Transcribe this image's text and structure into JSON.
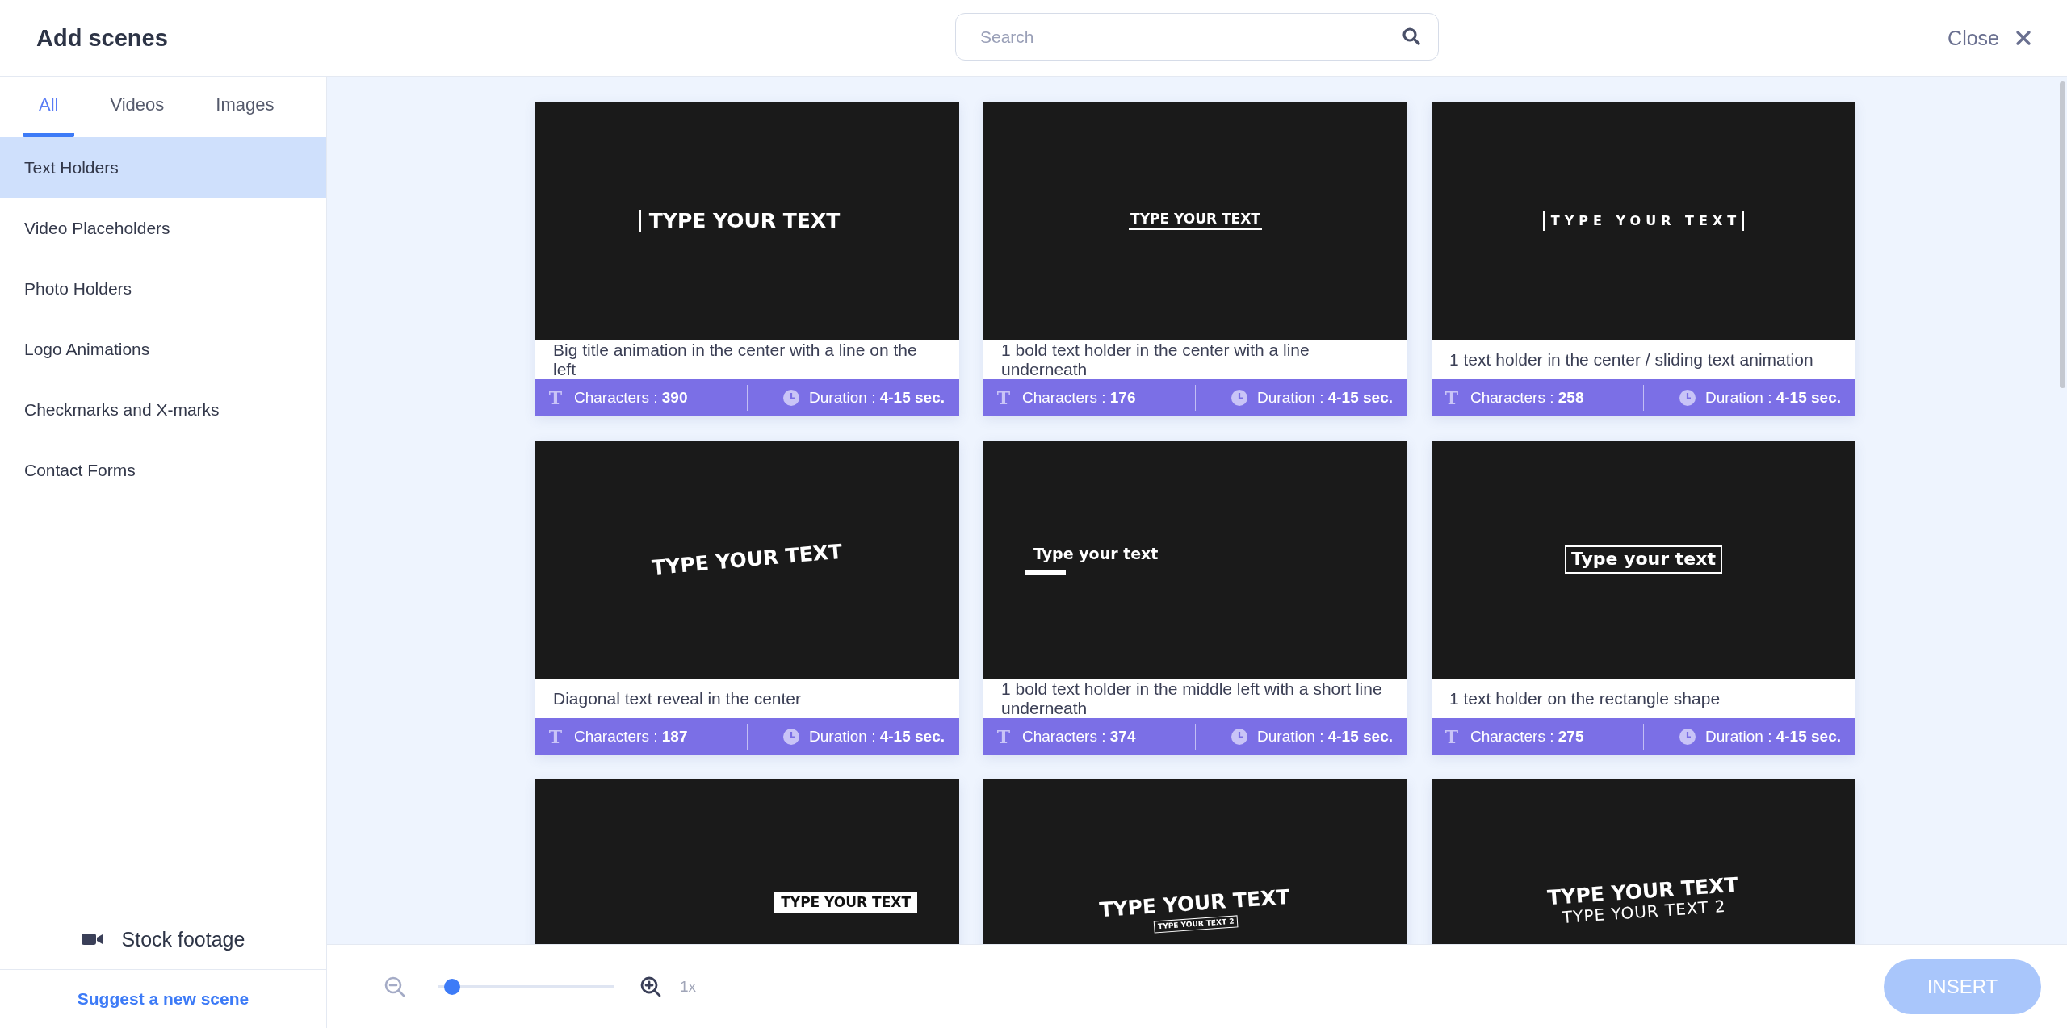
{
  "header": {
    "title": "Add scenes",
    "search": {
      "placeholder": "Search"
    },
    "close": "Close"
  },
  "sidebar": {
    "tabs": [
      {
        "label": "All",
        "selected": true
      },
      {
        "label": "Videos",
        "selected": false
      },
      {
        "label": "Images",
        "selected": false
      }
    ],
    "categories": [
      {
        "label": "Text Holders",
        "selected": true
      },
      {
        "label": "Video Placeholders",
        "selected": false
      },
      {
        "label": "Photo Holders",
        "selected": false
      },
      {
        "label": "Logo Animations",
        "selected": false
      },
      {
        "label": "Checkmarks and X-marks",
        "selected": false
      },
      {
        "label": "Contact Forms",
        "selected": false
      }
    ],
    "stock_footage": "Stock footage",
    "suggest_link": "Suggest a new scene"
  },
  "scenes": [
    {
      "preview": {
        "kind": "leftbar",
        "lines": [
          "TYPE YOUR TEXT"
        ]
      },
      "description": "Big title animation in the center with a line on the left",
      "footer": {
        "type_icon": "T",
        "characters": "Characters : **390**",
        "duration": "Duration : **4-15 sec.**"
      }
    },
    {
      "preview": {
        "kind": "underlined",
        "lines": [
          "TYPE YOUR TEXT"
        ]
      },
      "description": "1 bold text holder in the center with a line underneath",
      "footer": {
        "type_icon": "T",
        "characters": "Characters : **176**",
        "duration": "Duration : **4-15 sec.**"
      }
    },
    {
      "preview": {
        "kind": "bracketed",
        "lines": [
          "TYPE YOUR TEXT"
        ]
      },
      "description": "1 text holder in the center / sliding text animation",
      "footer": {
        "type_icon": "T",
        "characters": "Characters : **258**",
        "duration": "Duration : **4-15 sec.**"
      }
    },
    {
      "preview": {
        "kind": "diagonal",
        "lines": [
          "TYPE YOUR TEXT"
        ]
      },
      "description": "Diagonal text reveal in the center",
      "footer": {
        "type_icon": "T",
        "characters": "Characters : **187**",
        "duration": "Duration : **4-15 sec.**"
      }
    },
    {
      "preview": {
        "kind": "shortline",
        "lines": [
          "Type your text"
        ]
      },
      "description": "1 bold text holder in the middle left with a short line underneath",
      "footer": {
        "type_icon": "T",
        "characters": "Characters : **374**",
        "duration": "Duration : **4-15 sec.**"
      }
    },
    {
      "preview": {
        "kind": "outlined",
        "lines": [
          "Type your text"
        ]
      },
      "description": "1 text holder on the rectangle shape",
      "footer": {
        "type_icon": "T",
        "characters": "Characters : **275**",
        "duration": "Duration : **4-15 sec.**"
      }
    },
    {
      "preview": {
        "kind": "label",
        "lines": [
          "TYPE YOUR TEXT"
        ]
      }
    },
    {
      "preview": {
        "kind": "tiltedsub",
        "lines": [
          "TYPE YOUR TEXT",
          "TYPE YOUR TEXT 2"
        ]
      }
    },
    {
      "preview": {
        "kind": "twoline",
        "lines": [
          "TYPE YOUR TEXT",
          "TYPE YOUR TEXT 2"
        ]
      }
    }
  ],
  "zoom": {
    "level": 0.03,
    "reading": "1x"
  },
  "insert_button": "INSERT"
}
